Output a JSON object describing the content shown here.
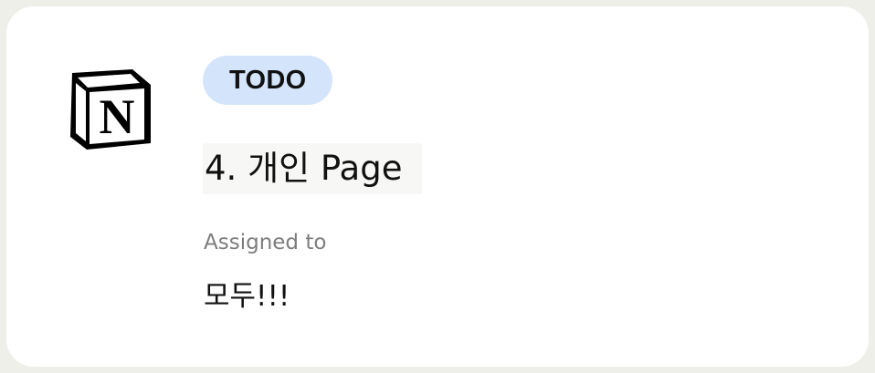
{
  "card": {
    "icon": "notion-logo",
    "status": "TODO",
    "title": "4. 개인 Page",
    "assigned_label": "Assigned to",
    "assigned_value": "모두!!!"
  },
  "colors": {
    "background": "#efefea",
    "card": "#ffffff",
    "badge": "#d4e5fb",
    "muted_text": "#7d7d7d",
    "text": "#111111"
  }
}
